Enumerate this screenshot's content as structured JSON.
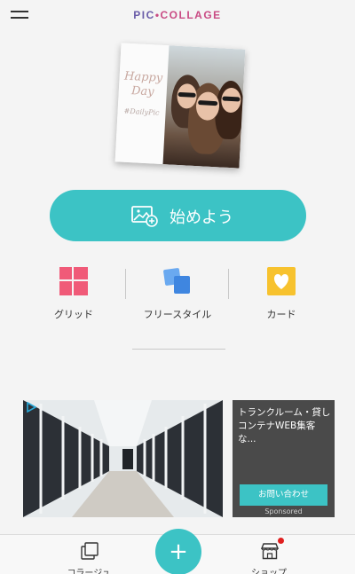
{
  "header": {
    "logo_part1": "PIC",
    "logo_dot": "•",
    "logo_part2": "COLLAGE",
    "menu_icon": "hamburger-menu-icon"
  },
  "hero": {
    "polaroid_text_line1": "Happy",
    "polaroid_text_line2": "Day",
    "polaroid_tag": "#DailyPic"
  },
  "start_button": {
    "label": "始めよう",
    "icon": "image-add-icon"
  },
  "options": [
    {
      "label": "グリッド",
      "icon": "grid-icon",
      "color": "#f05a78"
    },
    {
      "label": "フリースタイル",
      "icon": "freestyle-cards-icon",
      "color": "#4a90e2"
    },
    {
      "label": "カード",
      "icon": "heart-card-icon",
      "color": "#f7c22e"
    }
  ],
  "ad": {
    "title": "トランクルーム・貸しコンテナWEB集客な...",
    "cta_label": "お問い合わせ",
    "sponsored": "Sponsored",
    "badge_icon": "adchoices-icon"
  },
  "bottom_nav": {
    "items": [
      {
        "label": "コラージュ",
        "icon": "collage-icon"
      },
      {
        "label": "ショップ",
        "icon": "shop-icon"
      }
    ],
    "fab_label": "+"
  },
  "colors": {
    "accent": "#3cc3c5",
    "ad_panel": "#4a4a4a",
    "notification_dot": "#e02020"
  }
}
